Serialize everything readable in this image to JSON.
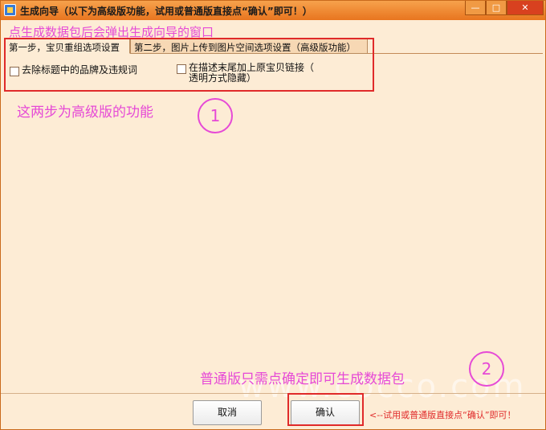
{
  "window": {
    "title": "生成向导（以下为高级版功能，试用或普通版直接点“确认”即可！）",
    "controls": {
      "minimize": "—",
      "maximize": "□",
      "close": "✕"
    }
  },
  "annotations": {
    "top_hint": "点生成数据包后会弹出生成向导的窗口",
    "mid_hint": "这两步为高级版的功能",
    "bottom_hint": "普通版只需点确定即可生成数据包",
    "circle_1": "1",
    "circle_2": "2",
    "watermark": "www.cocco.com"
  },
  "tabs": [
    {
      "label": "第一步，宝贝重组选项设置"
    },
    {
      "label": "第二步，图片上传到图片空间选项设置（高级版功能）"
    }
  ],
  "options": {
    "remove_brand": {
      "label": "去除标题中的品牌及违规词",
      "checked": false
    },
    "append_link": {
      "label_line1": "在描述末尾加上原宝贝链接（",
      "label_line2": "透明方式隐藏）",
      "checked": false
    }
  },
  "buttons": {
    "cancel": "取消",
    "ok": "确认"
  },
  "ok_hint": "<--试用或普通版直接点“确认”即可！",
  "colors": {
    "titlebar": "#e8751f",
    "annotation": "#e64ad6",
    "highlight": "#e02a2a",
    "background": "#fdecd5"
  }
}
